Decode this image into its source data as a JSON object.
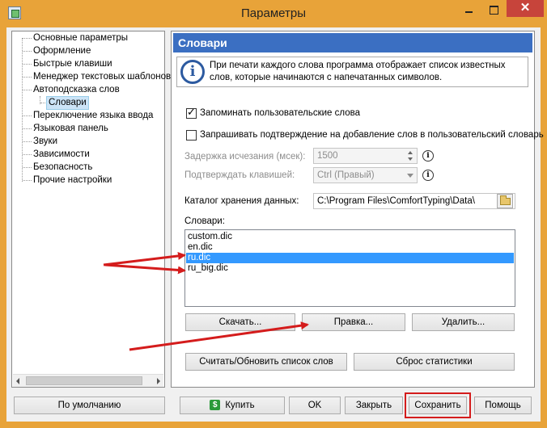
{
  "window": {
    "title": "Параметры",
    "close_glyph": "✕"
  },
  "tree": {
    "items": [
      "Основные параметры",
      "Оформление",
      "Быстрые клавиши",
      "Менеджер текстовых шаблонов",
      "Автоподсказка слов",
      "Словари",
      "Переключение языка ввода",
      "Языковая панель",
      "Звуки",
      "Зависимости",
      "Безопасность",
      "Прочие настройки"
    ],
    "selected": "Словари"
  },
  "panel": {
    "title": "Словари",
    "info_icon": "i",
    "info_text": "При печати каждого слова программа отображает список известных слов, которые начинаются с напечатанных символов.",
    "remember_words_label": "Запоминать пользовательские слова",
    "remember_words_checked": true,
    "confirm_add_label": "Запрашивать подтверждение на добавление слов в пользовательский словарь",
    "confirm_add_checked": false,
    "delay_label": "Задержка исчезания (мсек):",
    "delay_value": "1500",
    "confirm_key_label": "Подтверждать клавишей:",
    "confirm_key_value": "Ctrl (Правый)",
    "info_small_icon": "i",
    "storage_label": "Каталог хранения данных:",
    "storage_path": "C:\\Program Files\\ComfortTyping\\Data\\",
    "dictionaries_label": "Словари:",
    "dictionaries": [
      "custom.dic",
      "en.dic",
      "ru.dic",
      "ru_big.dic"
    ],
    "selected_dictionary": "ru.dic",
    "download_button": "Скачать...",
    "edit_button": "Правка...",
    "delete_button": "Удалить...",
    "refresh_button": "Считать/Обновить список слов",
    "reset_stats_button": "Сброс статистики"
  },
  "footer": {
    "defaults_button": "По умолчанию",
    "buy_icon": "$",
    "buy_button": "Купить",
    "ok_button": "OK",
    "close_button": "Закрыть",
    "save_button": "Сохранить",
    "help_button": "Помощь"
  },
  "colors": {
    "title_bar": "#e8a339",
    "panel_header": "#3b6fc2",
    "selection": "#3399ff",
    "annotation": "#d41c1c"
  }
}
